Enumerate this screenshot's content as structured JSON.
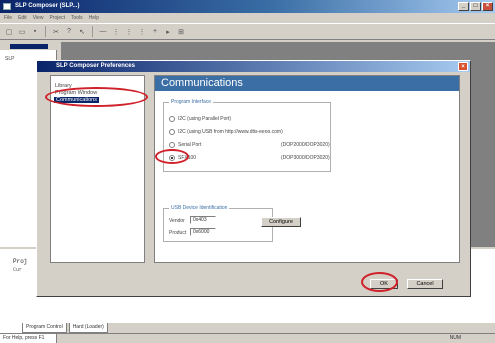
{
  "window": {
    "title": "SLP Composer (SLP...)"
  },
  "menubar": {
    "items": [
      "File",
      "Edit",
      "View",
      "Project",
      "Tools",
      "Help"
    ]
  },
  "project_pane": {
    "tree_root": "SLP"
  },
  "output": {
    "tag": "Proj",
    "lines": [
      "Proj",
      "Cur"
    ]
  },
  "bottom_tabs": [
    "Program Control",
    "Hard (Loader)"
  ],
  "status": {
    "left": "For Help, press F1",
    "right": "NUM"
  },
  "dialog": {
    "title": "SLP Composer Preferences",
    "nav": [
      "Library",
      "Program Window",
      "Communications"
    ],
    "selected_nav": "Communications",
    "header": "Communications",
    "programmer_group": "Program Interface",
    "options": [
      {
        "label": "I2C (using Parallel Port)",
        "model": "",
        "checked": false
      },
      {
        "label": "I2C (using USB from http://www.dtis-eeoo.com)",
        "model": "",
        "checked": false
      },
      {
        "label": "Serial Port",
        "model": "(DOP2000/DOP3020)",
        "checked": false
      },
      {
        "label": "SFX100",
        "model": "(DOP3000/DOP3020)",
        "checked": true
      }
    ],
    "usb_group": "USB Device Identification",
    "vendor_label": "Vendor",
    "vendor_value": "0x403",
    "product_label": "Product",
    "product_value": "0x6000",
    "configure_label": "Configure",
    "ok_label": "OK",
    "cancel_label": "Cancel"
  },
  "colors": {
    "callout": "#d0202a",
    "header_bg": "#3a6ea5",
    "titlebar": "#0a246a"
  }
}
